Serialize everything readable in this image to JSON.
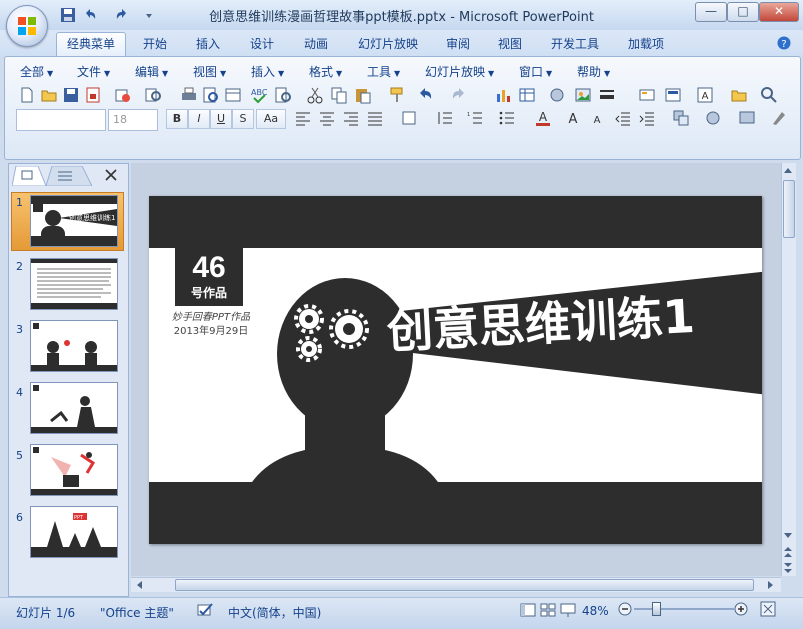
{
  "window": {
    "title": "创意思维训练漫画哲理故事ppt模板.pptx - Microsoft PowerPoint",
    "controls": {
      "minimize": "—",
      "maximize": "□",
      "close": "✕"
    }
  },
  "ribbon": {
    "tabs": [
      "经典菜单",
      "开始",
      "插入",
      "设计",
      "动画",
      "幻灯片放映",
      "审阅",
      "视图",
      "开发工具",
      "加载项"
    ],
    "active_tab": "经典菜单",
    "menus": [
      "全部",
      "文件",
      "编辑",
      "视图",
      "插入",
      "格式",
      "工具",
      "幻灯片放映",
      "窗口",
      "帮助"
    ],
    "font_size": "18",
    "format_buttons": [
      "B",
      "I",
      "U",
      "S",
      "Aa"
    ]
  },
  "thumbnails": [
    {
      "num": "1",
      "selected": true
    },
    {
      "num": "2",
      "selected": false
    },
    {
      "num": "3",
      "selected": false
    },
    {
      "num": "4",
      "selected": false
    },
    {
      "num": "5",
      "selected": false
    },
    {
      "num": "6",
      "selected": false
    }
  ],
  "slide": {
    "number": "46",
    "number_label": "号作品",
    "author": "妙手回春PPT作品",
    "date": "2013年9月29日",
    "title": "创意思维训练1"
  },
  "statusbar": {
    "slide_info": "幻灯片 1/6",
    "theme": "\"Office 主题\"",
    "language": "中文(简体，中国)",
    "zoom": "48%"
  },
  "colors": {
    "accent": "#d48b3a",
    "slide_dark": "#2d2d2d"
  }
}
